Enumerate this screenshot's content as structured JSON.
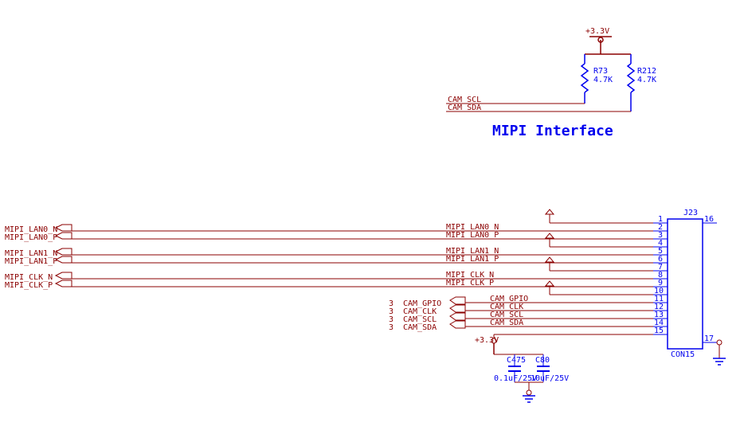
{
  "title": "MIPI Interface",
  "power_rail": "+3.3V",
  "pullups": {
    "r73_ref": "R73",
    "r73_val": "4.7K",
    "r212_ref": "R212",
    "r212_val": "4.7K",
    "scl_net": "CAM_SCL",
    "sda_net": "CAM_SDA"
  },
  "connector": {
    "ref": "J23",
    "type": "CON15",
    "pins_left": [
      "1",
      "2",
      "3",
      "4",
      "5",
      "6",
      "7",
      "8",
      "9",
      "10",
      "11",
      "12",
      "13",
      "14",
      "15"
    ],
    "pins_right": [
      "16",
      "17"
    ]
  },
  "left_ports": {
    "lan0n": "MIPI_LAN0_N",
    "lan0p": "MIPI_LAN0_P",
    "lan1n": "MIPI_LAN1_N",
    "lan1p": "MIPI_LAN1_P",
    "clkn": "MIPI_CLK_N",
    "clkp": "MIPI_CLK_P"
  },
  "offpage_ports": {
    "cam_gpio_page": "3",
    "cam_gpio": "CAM_GPIO",
    "cam_clk_page": "3",
    "cam_clk": "CAM_CLK",
    "cam_scl_page": "3",
    "cam_scl": "CAM_SCL",
    "cam_sda_page": "3",
    "cam_sda": "CAM_SDA"
  },
  "mid_nets": {
    "lan0n": "MIPI_LAN0_N",
    "lan0p": "MIPI_LAN0_P",
    "lan1n": "MIPI_LAN1_N",
    "lan1p": "MIPI_LAN1_P",
    "clkn": "MIPI_CLK_N",
    "clkp": "MIPI_CLK_P",
    "cam_gpio": "CAM_GPIO",
    "cam_clk": "CAM_CLK",
    "cam_scl": "CAM_SCL",
    "cam_sda": "CAM_SDA"
  },
  "decoupling": {
    "power": "+3.3V",
    "c475_ref": "C475",
    "c475_val": "0.1uF/25V",
    "c80_ref": "C80",
    "c80_val": "10uF/25V"
  }
}
